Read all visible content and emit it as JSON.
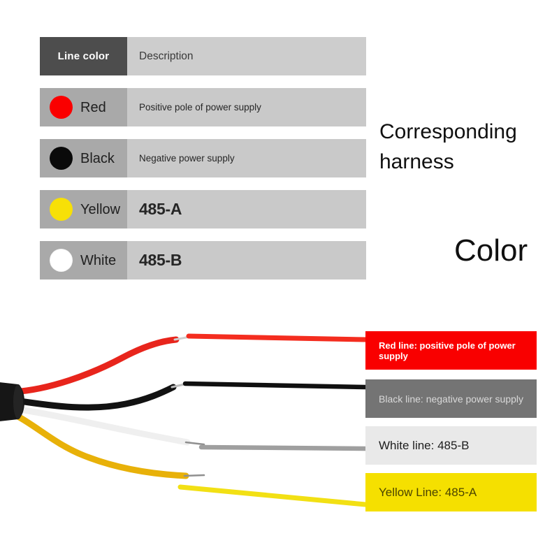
{
  "table": {
    "header": {
      "left": "Line color",
      "right": "Description"
    },
    "rows": [
      {
        "swatch": "red-circle-icon",
        "color_hex": "#fa0000",
        "name": "Red",
        "description": "Positive pole of power supply",
        "emphasis": "small"
      },
      {
        "swatch": "black-circle-icon",
        "color_hex": "#0a0a0a",
        "name": "Black",
        "description": "Negative power supply",
        "emphasis": "small"
      },
      {
        "swatch": "yellow-circle-icon",
        "color_hex": "#f7e007",
        "name": "Yellow",
        "description": "485-A",
        "emphasis": "big"
      },
      {
        "swatch": "white-circle-icon",
        "color_hex": "#ffffff",
        "name": "White",
        "description": "485-B",
        "emphasis": "big"
      }
    ]
  },
  "headings": {
    "corresponding_harness": "Corresponding harness",
    "color": "Color"
  },
  "diagram": {
    "legends": [
      {
        "key": "red",
        "label": "Red line: positive pole of power supply",
        "box_hex": "#f90000",
        "text_hex": "#ffffff"
      },
      {
        "key": "black",
        "label": "Black line: negative power supply",
        "box_hex": "#747474",
        "text_hex": "#d9d9d9"
      },
      {
        "key": "white",
        "label": "White line: 485-B",
        "box_hex": "#e9e9e9",
        "text_hex": "#1d1d1d"
      },
      {
        "key": "yellow",
        "label": "Yellow Line: 485-A",
        "box_hex": "#f5e000",
        "text_hex": "#4b4400"
      }
    ],
    "wires": [
      {
        "name": "red-wire",
        "hex": "#e8251c"
      },
      {
        "name": "black-wire",
        "hex": "#121212"
      },
      {
        "name": "white-wire",
        "hex": "#efefef"
      },
      {
        "name": "yellow-wire",
        "hex": "#e8b109"
      }
    ],
    "jacket": {
      "name": "cable-jacket",
      "hex": "#161616"
    }
  }
}
